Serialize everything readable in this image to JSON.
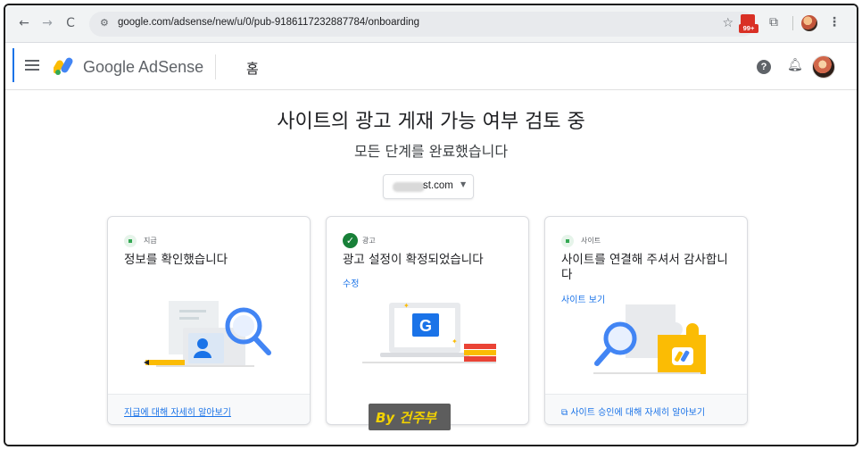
{
  "browser": {
    "url": "google.com/adsense/new/u/0/pub-9186117232887784/onboarding",
    "extension_badge": "99+"
  },
  "header": {
    "app_name": "Google AdSense",
    "page": "홈"
  },
  "main": {
    "title": "사이트의 광고 게재 가능 여부 검토 중",
    "subtitle": "모든 단계를 완료했습니다",
    "site_selector": {
      "value": "st.com"
    }
  },
  "cards": [
    {
      "tag": "지급",
      "status": "pending",
      "heading": "정보를 확인했습니다",
      "footer_link": "지급에 대해 자세히 알아보기"
    },
    {
      "tag": "광고",
      "status": "done",
      "heading": "광고 설정이 확정되었습니다",
      "link": "수정"
    },
    {
      "tag": "사이트",
      "status": "pending",
      "heading": "사이트를 연결해 주셔서 감사합니다",
      "link": "사이트 보기",
      "footer_link": "사이트 승인에 대해 자세히 알아보기"
    }
  ],
  "watermark": "By 건주부",
  "colors": {
    "accent": "#1a73e8",
    "success": "#188038",
    "success_bg": "#e6f4ea"
  },
  "icons": [
    "back-arrow-icon",
    "forward-arrow-icon",
    "reload-icon",
    "site-settings-icon",
    "bookmark-star-icon",
    "extension-icon",
    "puzzle-icon",
    "menu-icon",
    "help-icon",
    "bell-icon",
    "check-icon",
    "external-link-icon"
  ]
}
